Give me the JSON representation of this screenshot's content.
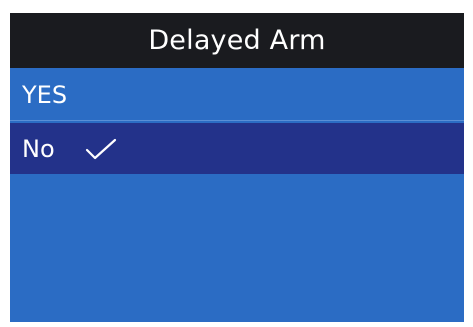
{
  "header": {
    "title": "Delayed Arm"
  },
  "options": [
    {
      "label": "YES",
      "selected": false
    },
    {
      "label": "No",
      "selected": true
    }
  ],
  "selected_icon": "checkmark-icon",
  "colors": {
    "header_bg": "#1a1b1f",
    "list_bg": "#2b6cc4",
    "selected_bg": "#23328a",
    "text": "#ffffff"
  }
}
